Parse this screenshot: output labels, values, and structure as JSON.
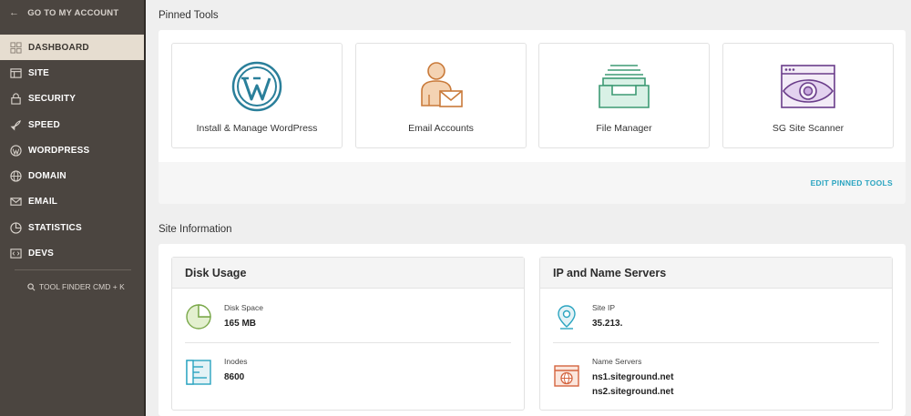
{
  "sidebar": {
    "back_label": "GO TO MY ACCOUNT",
    "items": [
      {
        "label": "DASHBOARD",
        "icon": "dashboard-icon",
        "active": true
      },
      {
        "label": "SITE",
        "icon": "site-icon"
      },
      {
        "label": "SECURITY",
        "icon": "lock-icon"
      },
      {
        "label": "SPEED",
        "icon": "rocket-icon"
      },
      {
        "label": "WORDPRESS",
        "icon": "wordpress-icon"
      },
      {
        "label": "DOMAIN",
        "icon": "globe-icon"
      },
      {
        "label": "EMAIL",
        "icon": "envelope-icon"
      },
      {
        "label": "STATISTICS",
        "icon": "pie-chart-icon"
      },
      {
        "label": "DEVS",
        "icon": "code-icon"
      }
    ],
    "tool_finder": "TOOL FINDER CMD + K"
  },
  "pinned": {
    "title": "Pinned Tools",
    "tools": [
      {
        "label": "Install & Manage WordPress",
        "icon": "wordpress-logo-icon"
      },
      {
        "label": "Email Accounts",
        "icon": "email-accounts-icon"
      },
      {
        "label": "File Manager",
        "icon": "file-manager-icon"
      },
      {
        "label": "SG Site Scanner",
        "icon": "site-scanner-icon"
      }
    ],
    "edit_label": "EDIT PINNED TOOLS"
  },
  "site_info": {
    "title": "Site Information",
    "disk_usage": {
      "title": "Disk Usage",
      "disk_space_label": "Disk Space",
      "disk_space_value": "165 MB",
      "inodes_label": "Inodes",
      "inodes_value": "8600"
    },
    "ip_servers": {
      "title": "IP and Name Servers",
      "site_ip_label": "Site IP",
      "site_ip_value": "35.213.",
      "name_servers_label": "Name Servers",
      "name_servers": [
        "ns1.siteground.net",
        "ns2.siteground.net"
      ]
    }
  },
  "colors": {
    "sidebar_bg": "#4b4540",
    "active_bg": "#e6ddd0",
    "accent": "#2aa4c0",
    "wordpress_blue": "#2a7f9a",
    "email_orange": "#c97a3a",
    "file_green": "#3d9a74",
    "scanner_purple": "#6a3d8a"
  }
}
